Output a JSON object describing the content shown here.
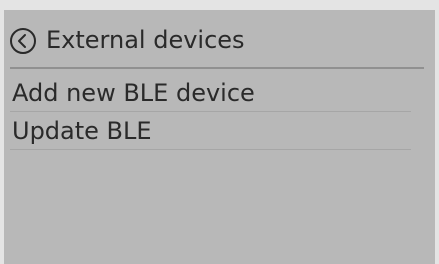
{
  "header": {
    "title": "External devices",
    "back_icon": "chevron-left-circle-icon"
  },
  "menu": {
    "items": [
      {
        "label": "Add new BLE device"
      },
      {
        "label": "Update BLE"
      }
    ]
  },
  "colors": {
    "screen_background": "#b8b8b8",
    "text": "#2a2a2a",
    "divider": "#909090"
  }
}
